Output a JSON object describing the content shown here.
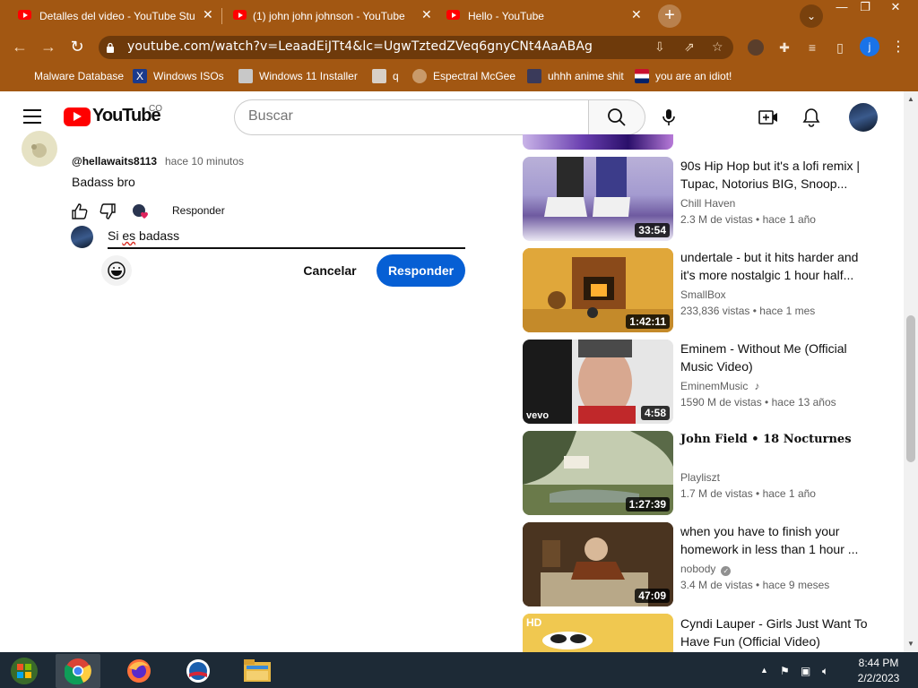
{
  "browser": {
    "tabs": [
      {
        "title": "Detalles del video - YouTube Stu",
        "active": false
      },
      {
        "title": "(1) john john johnson - YouTube",
        "active": true
      },
      {
        "title": "Hello - YouTube",
        "active": false
      }
    ],
    "new_tab": "+",
    "url": "youtube.com/watch?v=LeaadEiJTt4&lc=UgwTztedZVeq6gnyCNt4AaABAg",
    "profile_initial": "j",
    "bookmarks": [
      {
        "label": "Malware Database",
        "icon": "malware-icon"
      },
      {
        "label": "Windows ISOs",
        "icon": "x-icon"
      },
      {
        "label": "Windows 11 Installer",
        "icon": "installer-icon"
      },
      {
        "label": "q",
        "icon": "q-icon"
      },
      {
        "label": "Espectral McGee",
        "icon": "face-icon"
      },
      {
        "label": "uhhh anime shit",
        "icon": "anime-icon"
      },
      {
        "label": "you are an idiot!",
        "icon": "flag-icon"
      }
    ]
  },
  "youtube": {
    "logo_text": "YouTube",
    "country": "CO",
    "search_placeholder": "Buscar"
  },
  "comment": {
    "author": "@hellawaits8113",
    "time": "hace 10 minutos",
    "text": "Badass bro",
    "reply_link": "Responder",
    "reply_draft_prefix": "Si ",
    "reply_draft_misspelled": "es",
    "reply_draft_suffix": " badass",
    "cancel_label": "Cancelar",
    "submit_label": "Responder"
  },
  "related": [
    {
      "title": "90s Hip Hop but it's a lofi remix | Tupac, Notorius BIG, Snoop...",
      "channel": "Chill Haven",
      "views": "2.3 M de vistas",
      "age": "hace 1 año",
      "duration": "33:54",
      "badge": ""
    },
    {
      "title": "undertale - but it hits harder and it's more nostalgic 1 hour half...",
      "channel": "SmallBox",
      "views": "233,836 vistas",
      "age": "hace 1 mes",
      "duration": "1:42:11",
      "badge": ""
    },
    {
      "title": "Eminem - Without Me (Official Music Video)",
      "channel": "EminemMusic",
      "views": "1590 M de vistas",
      "age": "hace 13 años",
      "duration": "4:58",
      "badge": "music-note-icon"
    },
    {
      "title": "John Field • 18 Nocturnes",
      "channel": "Playliszt",
      "views": "1.7 M de vistas",
      "age": "hace 1 año",
      "duration": "1:27:39",
      "badge": ""
    },
    {
      "title": "when you have to finish your homework in less than 1 hour ...",
      "channel": "nobody",
      "views": "3.4 M de vistas",
      "age": "hace 9 meses",
      "duration": "47:09",
      "badge": "verified-icon"
    },
    {
      "title": "Cyndi Lauper - Girls Just Want To Have Fun (Official Video)",
      "channel": "",
      "views": "",
      "age": "",
      "duration": "",
      "badge": ""
    }
  ],
  "taskbar": {
    "time": "8:44 PM",
    "date": "2/2/2023"
  },
  "colors": {
    "chrome_frame": "#a25712",
    "yt_red": "#ff0000",
    "reply_button": "#065fd4"
  }
}
